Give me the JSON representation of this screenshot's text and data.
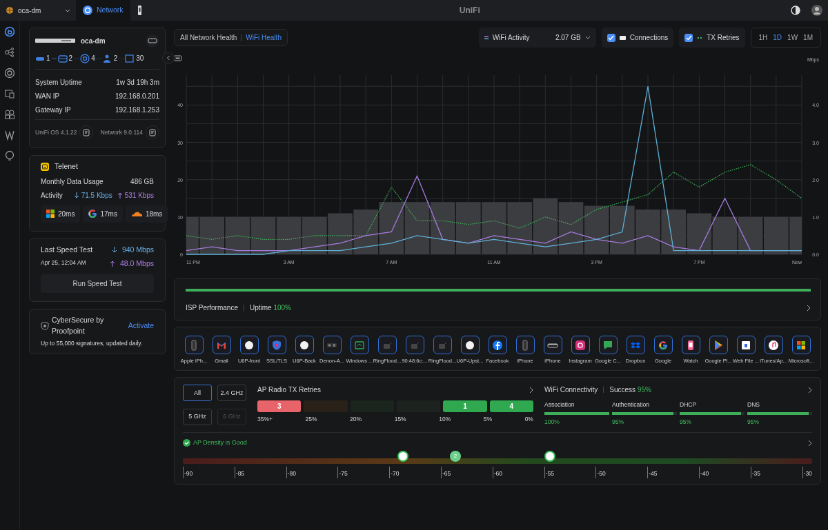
{
  "topbar": {
    "site": "oca-dm",
    "tabs": [
      {
        "kind": "app",
        "label": "Network",
        "selected": true
      },
      {
        "kind": "device",
        "selected": false
      }
    ],
    "title": "UniFi"
  },
  "sidebar": {
    "items": [
      {
        "kind": "dashboard",
        "selected": true
      },
      {
        "kind": "topology",
        "selected": false
      },
      {
        "kind": "radar",
        "selected": false
      },
      {
        "kind": "devices",
        "selected": false
      },
      {
        "kind": "clients",
        "selected": false
      },
      {
        "kind": "insights",
        "selected": false
      },
      {
        "kind": "bulb",
        "selected": false
      }
    ]
  },
  "device_card": {
    "name": "oca-dm",
    "topology": [
      "1",
      "2",
      "4",
      "2",
      "30"
    ],
    "stats": [
      {
        "label": "System Uptime",
        "value": "1w 3d 19h 3m"
      },
      {
        "label": "WAN IP",
        "value": "192.168.0.201"
      },
      {
        "label": "Gateway IP",
        "value": "192.168.1.253"
      }
    ],
    "versions": [
      "UniFi OS 4.1.22",
      "Network 9.0.114"
    ]
  },
  "isp_card": {
    "name": "Telenet",
    "usage_label": "Monthly Data Usage",
    "usage": "486 GB",
    "activity_label": "Activity",
    "download": "71.5 Kbps",
    "upload": "531 Kbps",
    "latency": [
      {
        "kind": "microsoft",
        "value": "20ms"
      },
      {
        "kind": "google",
        "value": "17ms"
      },
      {
        "kind": "cloudflare",
        "value": "18ms"
      }
    ]
  },
  "speed_test": {
    "label": "Last Speed Test",
    "date": "Apr 25, 12:04 AM",
    "download": "940 Mbps",
    "upload": "48.0 Mbps",
    "button": "Run Speed Test"
  },
  "cybersecure": {
    "title": "CyberSecure by Proofpoint",
    "link": "Activate",
    "description": "Up to 55,000 signatures, updated daily."
  },
  "health_tabs": [
    {
      "label": "All Network Health",
      "selected": false
    },
    {
      "label": "WiFi Health",
      "selected": true
    }
  ],
  "chart_controls": {
    "activity_value": "2.07 GB",
    "toggles": [
      {
        "checked": true
      },
      {
        "checked": true
      }
    ],
    "ranges": [
      {
        "label": "1H",
        "selected": false
      },
      {
        "label": "1D",
        "selected": true
      },
      {
        "label": "1W",
        "selected": false
      },
      {
        "label": "1M",
        "selected": false
      }
    ]
  },
  "chart_data": {
    "type": "line",
    "grid": true,
    "ylim": [
      0,
      48
    ],
    "y2label": "Mbps",
    "y2lim": [
      0,
      4.8
    ],
    "categories": [
      "11 PM",
      null,
      null,
      null,
      "3 AM",
      null,
      null,
      null,
      "7 AM",
      null,
      null,
      null,
      "11 AM",
      null,
      null,
      null,
      "3 PM",
      null,
      null,
      null,
      "7 PM",
      null,
      null,
      null,
      "Now"
    ],
    "yticks": [
      0,
      10,
      20,
      30,
      40
    ],
    "y2ticks": [
      {
        "value": 0,
        "label": "0.0"
      },
      {
        "value": 1,
        "label": "1.0"
      },
      {
        "value": 2,
        "label": "2.0"
      },
      {
        "value": 3,
        "label": "3.0"
      },
      {
        "value": 4,
        "label": "4.0"
      }
    ],
    "series": [
      {
        "name": "Connections",
        "type": "bar",
        "color": "#3c3d40",
        "values": [
          10,
          10,
          10,
          10,
          10,
          10,
          11,
          12,
          14,
          14,
          14,
          14,
          14,
          14,
          15,
          14,
          13,
          13,
          12,
          12,
          11,
          10,
          10,
          10,
          10
        ]
      },
      {
        "name": "TX Retries",
        "line_style": "dotted",
        "color": "#3fae5a",
        "values": [
          5,
          4,
          5,
          4,
          4,
          5,
          5,
          5,
          18,
          9,
          9,
          8,
          9,
          7,
          10,
          8,
          12,
          14,
          16,
          22,
          18,
          22,
          24,
          20,
          15
        ]
      },
      {
        "name": "WiFi Activity",
        "axis": "y2",
        "color": "#a77be0",
        "values": [
          0.1,
          0.2,
          0.1,
          0.1,
          0.1,
          0.2,
          0.3,
          0.5,
          0.6,
          2.1,
          0.4,
          0.3,
          0.5,
          0.4,
          0.3,
          0.6,
          0.4,
          0.3,
          0.5,
          0.2,
          0.1,
          1.5,
          0.1,
          0.1,
          0.1
        ]
      },
      {
        "axis": "y2",
        "color": "#5fb0d8",
        "values": [
          0,
          0,
          0,
          0,
          0.1,
          0.1,
          0.1,
          0.2,
          0.3,
          0.5,
          0.4,
          0.3,
          0.4,
          0.3,
          0.2,
          0.3,
          0.4,
          0.6,
          4.5,
          0.1,
          0.1,
          0.1,
          0.1,
          0.1,
          0.1
        ]
      }
    ]
  },
  "isp_performance": {
    "label": "ISP Performance",
    "uptime_label": "Uptime",
    "uptime": "100%",
    "level": 1
  },
  "apps": [
    {
      "label": "Apple iPh...",
      "kind": "phone"
    },
    {
      "label": "Gmail",
      "kind": "gmail"
    },
    {
      "label": "U6P-front",
      "kind": "ap"
    },
    {
      "label": "SSL/TLS",
      "kind": "shield"
    },
    {
      "label": "U6P-Back",
      "kind": "ap"
    },
    {
      "label": "Denon-A...",
      "kind": "speaker"
    },
    {
      "label": "Windows ...",
      "kind": "windows"
    },
    {
      "label": "RingFlood...",
      "kind": "camera"
    },
    {
      "label": "90:48:6c:...",
      "kind": "camera"
    },
    {
      "label": "RingFlood...",
      "kind": "camera"
    },
    {
      "label": "U6P-Upst...",
      "kind": "ap"
    },
    {
      "label": "Facebook",
      "kind": "facebook"
    },
    {
      "label": "iPhone",
      "kind": "phone"
    },
    {
      "label": "iPhone",
      "kind": "tablet"
    },
    {
      "label": "Instagram",
      "kind": "instagram"
    },
    {
      "label": "Google C...",
      "kind": "chat"
    },
    {
      "label": "Dropbox",
      "kind": "dropbox"
    },
    {
      "label": "Google",
      "kind": "google"
    },
    {
      "label": "Watch",
      "kind": "watch"
    },
    {
      "label": "Google Pl...",
      "kind": "play"
    },
    {
      "label": "Web File ...",
      "kind": "file"
    },
    {
      "label": "iTunes/Ap...",
      "kind": "music"
    },
    {
      "label": "Microsoft...",
      "kind": "microsoft"
    }
  ],
  "retries": {
    "title": "AP Radio TX Retries",
    "bands": [
      {
        "label": "All",
        "selected": true,
        "disabled": false
      },
      {
        "label": "2.4 GHz",
        "selected": false,
        "disabled": false
      },
      {
        "label": "5 GHz",
        "selected": false,
        "disabled": false
      },
      {
        "label": "6 GHz",
        "selected": false,
        "disabled": true
      }
    ],
    "segments": [
      {
        "count": "3",
        "color": "#e8636a"
      },
      {
        "color": "#2a2219"
      },
      {
        "color": "#1a261d"
      },
      {
        "color": "#1c231e"
      },
      {
        "count": "1",
        "color": "#2fa84f"
      },
      {
        "count": "4",
        "color": "#2fa84f"
      }
    ],
    "scale": [
      "35%+",
      "25%",
      "20%",
      "15%",
      "10%",
      "5%",
      "0%"
    ]
  },
  "connectivity": {
    "title": "WiFi Connectivity",
    "success_label": "Success",
    "success": "95%",
    "metrics": [
      {
        "label": "Association",
        "value": "100%",
        "level": 1
      },
      {
        "label": "Authentication",
        "value": "95%",
        "level": 0.95
      },
      {
        "label": "DHCP",
        "value": "95%",
        "level": 0.95
      },
      {
        "label": "DNS",
        "value": "95%",
        "level": 0.95
      }
    ]
  },
  "density": {
    "status": "AP Density is Good",
    "ticks": [
      "-90",
      "-85",
      "-80",
      "-75",
      "-70",
      "-65",
      "-60",
      "-55",
      "-50",
      "-45",
      "-40",
      "-35",
      "-30"
    ],
    "markers": [
      {
        "level": 0.35
      },
      {
        "level": 0.433,
        "count": "2"
      },
      {
        "level": 0.583
      }
    ]
  }
}
